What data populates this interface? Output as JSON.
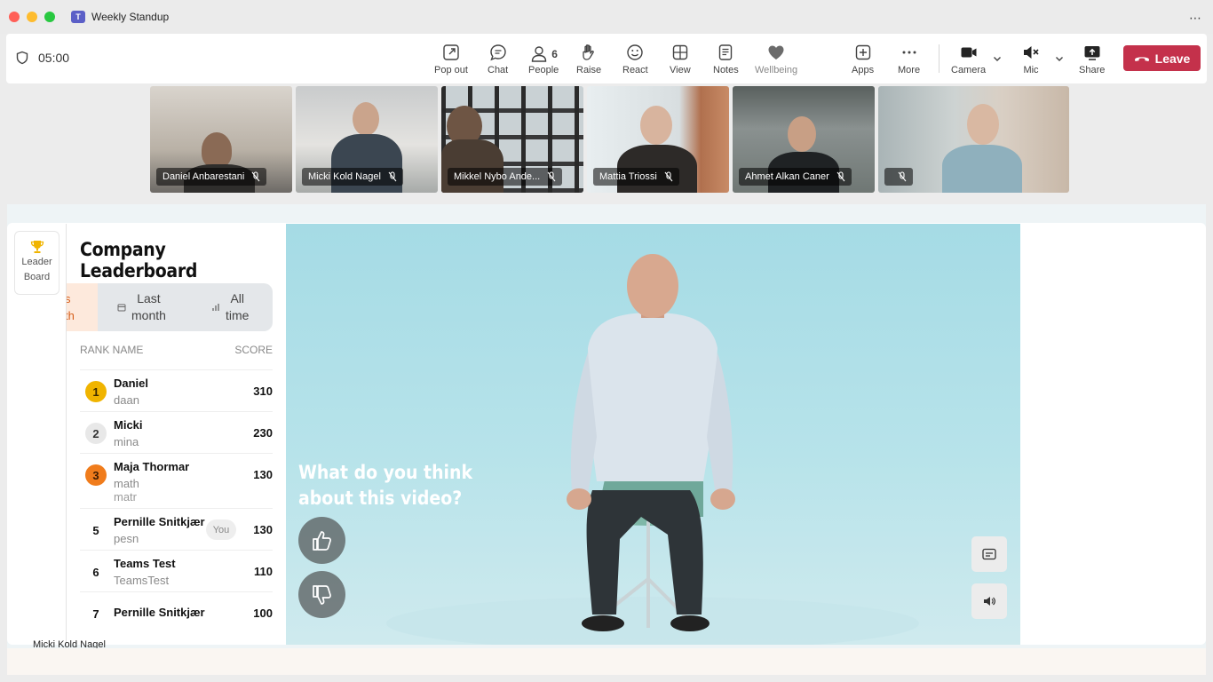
{
  "window": {
    "title": "Weekly Standup",
    "more": "⋯"
  },
  "meeting": {
    "timer": "05:00"
  },
  "toolbar": {
    "pop_out": "Pop out",
    "chat": "Chat",
    "people": "People",
    "people_count": "6",
    "raise": "Raise",
    "react": "React",
    "view": "View",
    "notes": "Notes",
    "wellbeing": "Wellbeing",
    "apps": "Apps",
    "more": "More",
    "camera": "Camera",
    "mic": "Mic",
    "share": "Share",
    "leave": "Leave"
  },
  "participants": [
    {
      "name": "Daniel Anbarestani"
    },
    {
      "name": "Micki Kold Nagel"
    },
    {
      "name": "Mikkel Nybo Ande..."
    },
    {
      "name": "Mattia Triossi"
    },
    {
      "name": "Ahmet Alkan Caner"
    },
    {
      "name": ""
    }
  ],
  "rail": {
    "line1": "Leader",
    "line2": "Board"
  },
  "leaderboard": {
    "title": "Company Leaderboard",
    "filters": {
      "cut_top": "s",
      "cut_bottom": "th",
      "last_month_1": "Last",
      "last_month_2": "month",
      "all_time_1": "All",
      "all_time_2": "time"
    },
    "header": {
      "rank_name": "RANK NAME",
      "score": "SCORE"
    },
    "rows": [
      {
        "rank": "1",
        "name": "Daniel",
        "user": "daan",
        "score": "310"
      },
      {
        "rank": "2",
        "name": "Micki",
        "user": "mina",
        "score": "230"
      },
      {
        "rank": "3",
        "name": "Maja Thormar",
        "user": "math",
        "user_ghost": "matr",
        "score": "130"
      },
      {
        "rank": "5",
        "name": "Pernille Snitkjær",
        "user": "pesn",
        "score": "130",
        "badge": "You"
      },
      {
        "rank": "6",
        "name": "Teams Test",
        "user": "TeamsTest",
        "score": "110"
      },
      {
        "rank": "7",
        "name": "Pernille Snitkjær",
        "user": "",
        "score": "100"
      }
    ]
  },
  "video": {
    "question_1": "What do you think",
    "question_2": "about this video?"
  },
  "stage_caption": "Micki Kold Nagel",
  "colors": {
    "leave": "#c4314b",
    "rank_gold": "#f0b400",
    "rank_bronze": "#f07c1c",
    "brand": "#5b5fc7"
  }
}
